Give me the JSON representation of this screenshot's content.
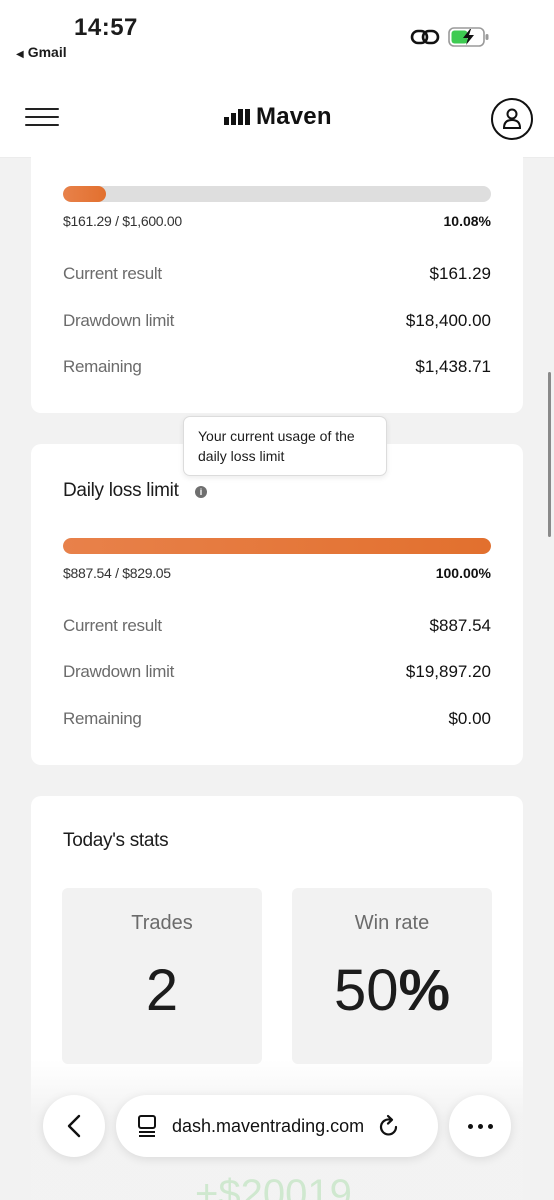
{
  "status_bar": {
    "time": "14:57",
    "back_app": "Gmail",
    "back_arrow": "◀"
  },
  "nav": {
    "brand": "Maven",
    "icons": {
      "menu": "hamburger-icon",
      "profile": "user-icon",
      "logo": "bar-chart-icon"
    }
  },
  "overall_loss": {
    "progress_label": "$161.29 / $1,600.00",
    "progress_percent_text": "10.08%",
    "progress_fraction": 0.1008,
    "rows": [
      {
        "label": "Current result",
        "value": "$161.29"
      },
      {
        "label": "Drawdown limit",
        "value": "$18,400.00"
      },
      {
        "label": "Remaining",
        "value": "$1,438.71"
      }
    ]
  },
  "daily_loss": {
    "title": "Daily loss limit",
    "info_glyph": "i",
    "tooltip": "Your current usage of the daily loss limit",
    "progress_label": "$887.54 / $829.05",
    "progress_percent_text": "100.00%",
    "progress_fraction": 1.0,
    "rows": [
      {
        "label": "Current result",
        "value": "$887.54"
      },
      {
        "label": "Drawdown limit",
        "value": "$19,897.20"
      },
      {
        "label": "Remaining",
        "value": "$0.00"
      }
    ]
  },
  "stats": {
    "title": "Today's stats",
    "trades_label": "Trades",
    "trades_value": "2",
    "winrate_label": "Win rate",
    "winrate_number": "50",
    "winrate_symbol": "%",
    "partial_value": "+$20019"
  },
  "browser": {
    "url": "dash.maventrading.com",
    "icons": {
      "back": "chevron-left-icon",
      "tabs": "page-icon",
      "reload": "reload-icon",
      "more": "more-icon"
    }
  },
  "colors": {
    "accent": "#e2702e",
    "track": "#dedede",
    "background": "#f2f2f2"
  }
}
